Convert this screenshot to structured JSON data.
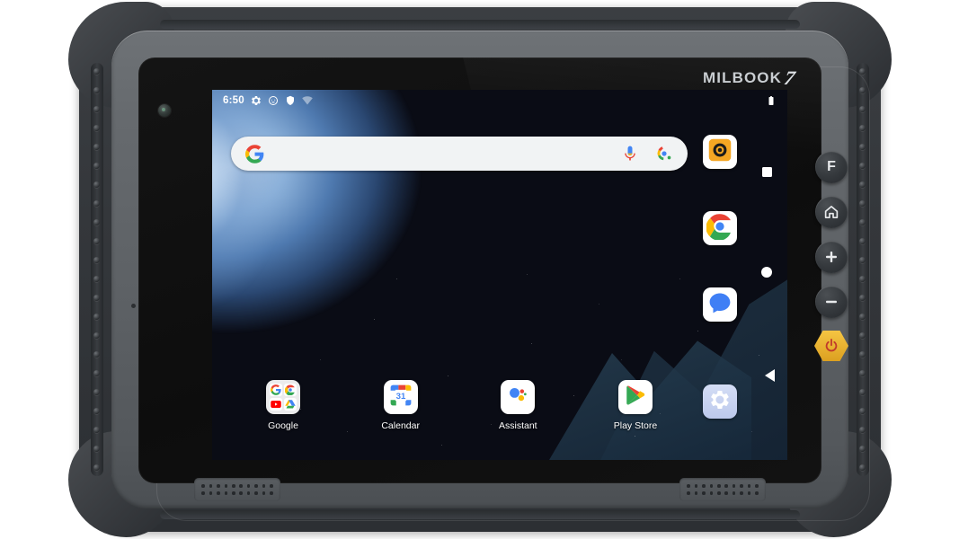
{
  "device": {
    "brand_text": "MILBOOK",
    "brand_mark": "7",
    "type": "rugged-android-tablet"
  },
  "hardware_buttons": [
    {
      "name": "function-button",
      "label": "F",
      "icon": "letter-f"
    },
    {
      "name": "home-button",
      "label": "",
      "icon": "home-icon"
    },
    {
      "name": "volume-up-button",
      "label": "+",
      "icon": "plus-icon"
    },
    {
      "name": "volume-down-button",
      "label": "−",
      "icon": "minus-icon"
    },
    {
      "name": "power-button",
      "label": "",
      "icon": "power-icon",
      "color": "#f0b429"
    }
  ],
  "screen": {
    "status_bar": {
      "clock": "6:50",
      "left_icons": [
        "gear-icon",
        "clock-face-icon",
        "shield-icon",
        "wifi-no-internet-icon"
      ],
      "right_icons": [
        "battery-icon"
      ]
    },
    "search": {
      "placeholder": "",
      "value": "",
      "leading_icon": "google-g-icon",
      "trailing_icons": [
        "microphone-icon",
        "google-lens-icon"
      ]
    },
    "side_apps": [
      {
        "name": "camera-app",
        "icon": "camera-orange-icon",
        "label": ""
      },
      {
        "name": "chrome-app",
        "icon": "chrome-icon",
        "label": ""
      },
      {
        "name": "messages-app",
        "icon": "messages-icon",
        "label": ""
      }
    ],
    "settings_app": {
      "name": "settings-app",
      "icon": "gear-icon",
      "label": ""
    },
    "nav_hints": [
      "recents-square",
      "home-circle",
      "back-triangle"
    ],
    "dock": [
      {
        "name": "google-folder",
        "label": "Google",
        "icon": "folder-grid",
        "folder_items": [
          "google-g-icon",
          "chrome-icon",
          "youtube-icon",
          "drive-icon"
        ]
      },
      {
        "name": "calendar-app",
        "label": "Calendar",
        "icon": "calendar-icon",
        "day": "31"
      },
      {
        "name": "assistant-app",
        "label": "Assistant",
        "icon": "assistant-icon"
      },
      {
        "name": "play-store-app",
        "label": "Play Store",
        "icon": "play-store-icon"
      }
    ],
    "wallpaper": {
      "style": "dark-blue-night-ridge",
      "accent_color": "#8fb4dc",
      "base_color": "#0a0c15"
    }
  }
}
